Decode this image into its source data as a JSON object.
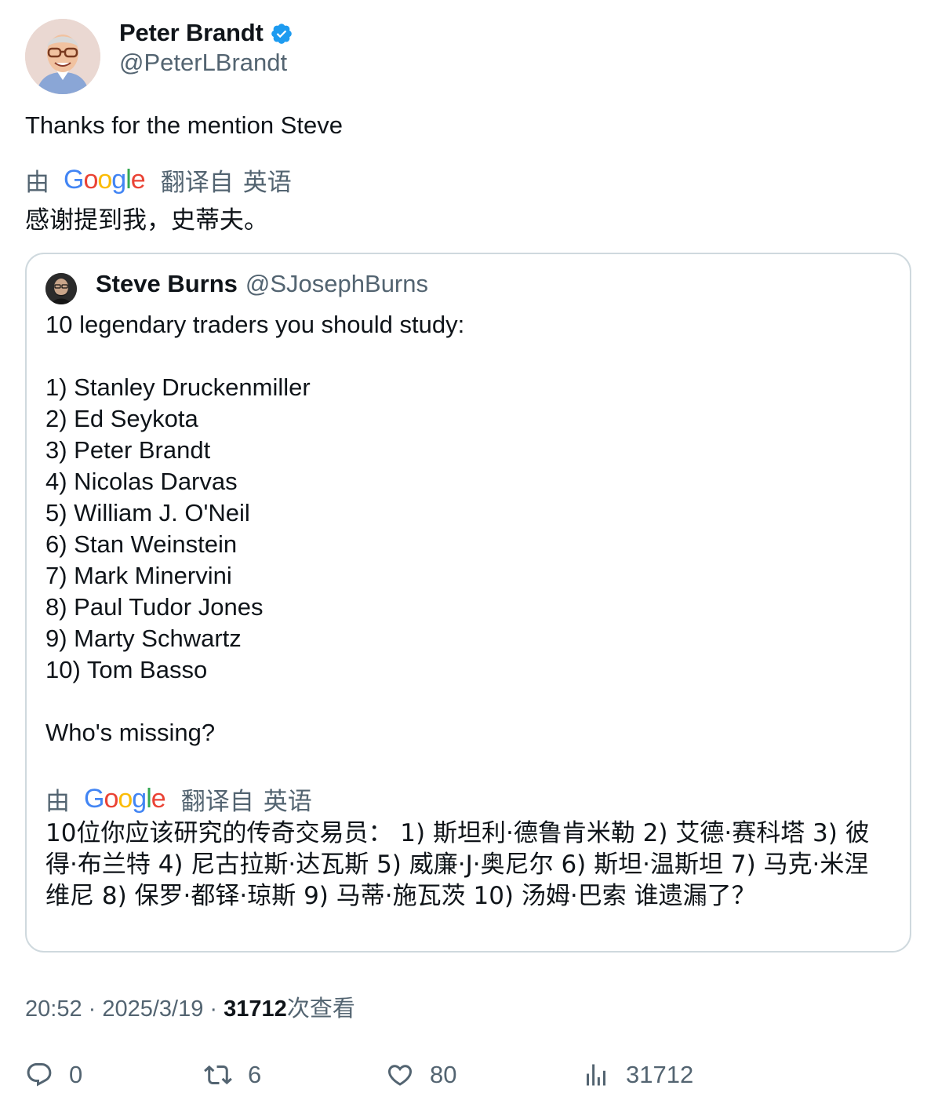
{
  "author": {
    "name": "Peter Brandt",
    "handle": "@PeterLBrandt",
    "verified": true
  },
  "tweet": {
    "text": "Thanks for the mention Steve",
    "translation": {
      "by": "由",
      "provider": "Google",
      "from_label": "翻译自",
      "language": "英语",
      "text": "感谢提到我，史蒂夫。"
    }
  },
  "quote": {
    "name": "Steve Burns",
    "handle": "@SJosephBurns",
    "lines": [
      "10 legendary traders you should study:",
      "",
      "1) Stanley Druckenmiller",
      "2) Ed Seykota",
      "3) Peter Brandt",
      "4) Nicolas Darvas",
      "5) William J. O'Neil",
      "6) Stan Weinstein",
      "7) Mark Minervini",
      "8) Paul Tudor Jones",
      "9) Marty Schwartz",
      "10) Tom Basso",
      "",
      "Who's missing?"
    ],
    "translation": {
      "by": "由",
      "provider": "Google",
      "from_label": "翻译自",
      "language": "英语",
      "text": "10位你应该研究的传奇交易员： 1) 斯坦利·德鲁肯米勒 2) 艾德·赛科塔 3) 彼得·布兰特 4) 尼古拉斯·达瓦斯 5) 威廉·J·奥尼尔 6) 斯坦·温斯坦 7) 马克·米涅维尼 8) 保罗·都铎·琼斯 9) 马蒂·施瓦茨 10) 汤姆·巴索 谁遗漏了？"
    }
  },
  "meta": {
    "time": "20:52",
    "separator": " · ",
    "date": "2025/3/19",
    "views_count": "31712",
    "views_label": "次查看"
  },
  "actions": {
    "replies": "0",
    "reposts": "6",
    "likes": "80",
    "views": "31712"
  },
  "colors": {
    "verified_badge": "#1d9bf0",
    "secondary_text": "#536471",
    "primary_text": "#0f1419",
    "card_border": "#cfd9de",
    "google_blue": "#4285f4",
    "google_red": "#ea4335",
    "google_yellow": "#fbbc05",
    "google_green": "#34a853"
  },
  "icons": {
    "verified": "verified-badge-icon",
    "reply": "reply-icon",
    "repost": "repost-icon",
    "like": "heart-icon",
    "views": "views-chart-icon"
  }
}
